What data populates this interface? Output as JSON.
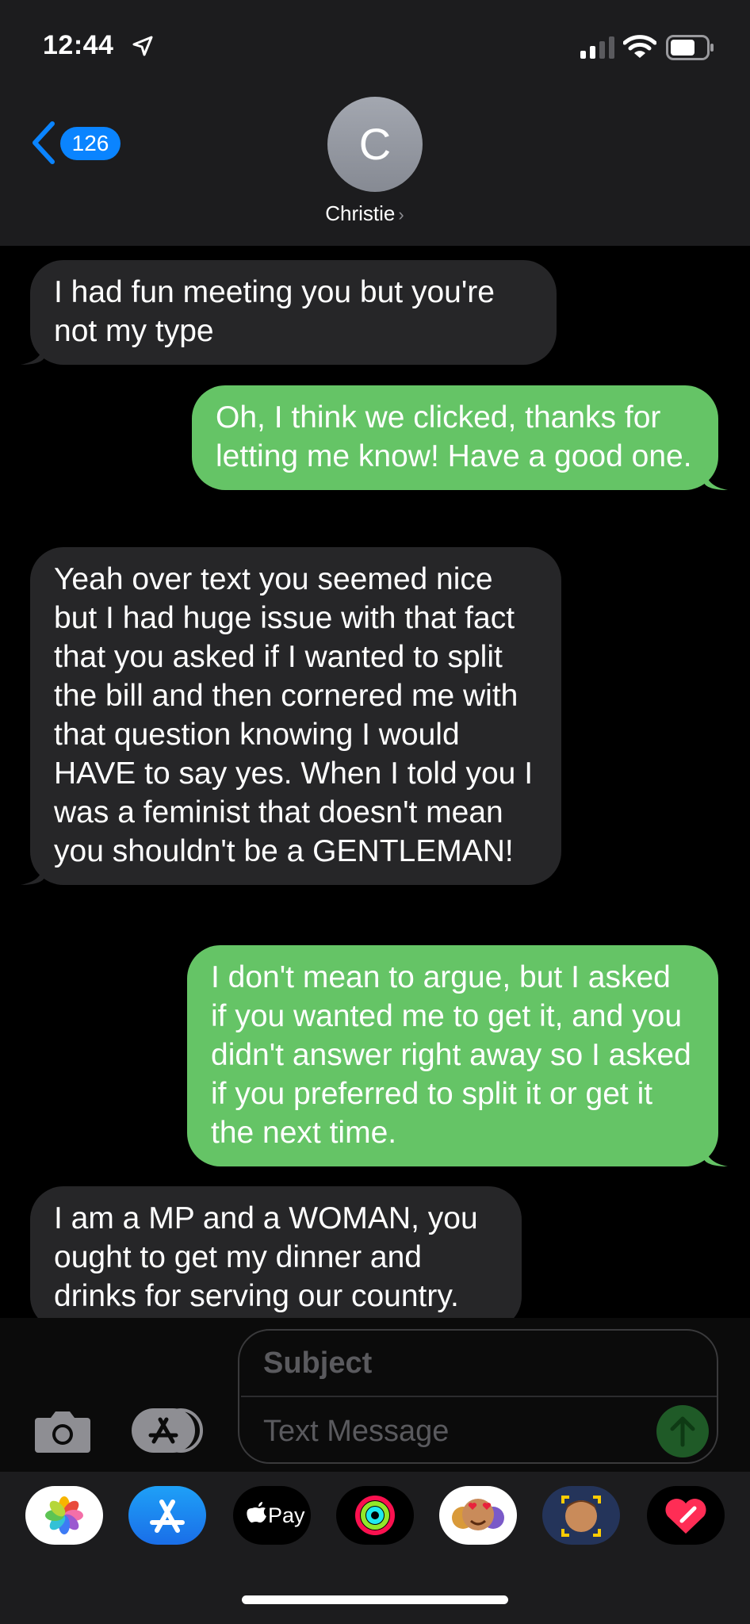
{
  "status_bar": {
    "time": "12:44"
  },
  "nav": {
    "back_count": "126",
    "avatar_initial": "C",
    "contact_name": "Christie"
  },
  "messages": [
    {
      "direction": "incoming",
      "text": "I had fun meeting you but you're not my type"
    },
    {
      "direction": "outgoing",
      "text": "Oh, I think we clicked, thanks for letting me know! Have a good one."
    },
    {
      "direction": "incoming",
      "text": "Yeah over text you seemed nice but I had huge issue with that fact that you asked if I wanted to split the bill and then cornered me with that question knowing I would HAVE to say yes. When I told you I was a feminist that doesn't mean you shouldn't be a GENTLEMAN!"
    },
    {
      "direction": "outgoing",
      "text": "I don't mean to argue, but I asked if you wanted me to get it, and you didn't answer right away so I asked if you preferred to split it or get it the next time."
    },
    {
      "direction": "incoming",
      "text": "I am a MP and a WOMAN, you ought to get my dinner and drinks for serving our country."
    }
  ],
  "compose": {
    "subject_placeholder": "Subject",
    "message_placeholder": "Text Message"
  },
  "app_drawer": {
    "apps": [
      {
        "icon": "photos-icon"
      },
      {
        "icon": "app-store-icon"
      },
      {
        "icon": "apple-pay-icon",
        "label": "Pay"
      },
      {
        "icon": "activity-icon"
      },
      {
        "icon": "animoji-icon"
      },
      {
        "icon": "memoji-icon"
      },
      {
        "icon": "digital-touch-icon"
      }
    ]
  },
  "colors": {
    "incoming": "#262628",
    "outgoing": "#65c466",
    "accent": "#0a84ff"
  }
}
